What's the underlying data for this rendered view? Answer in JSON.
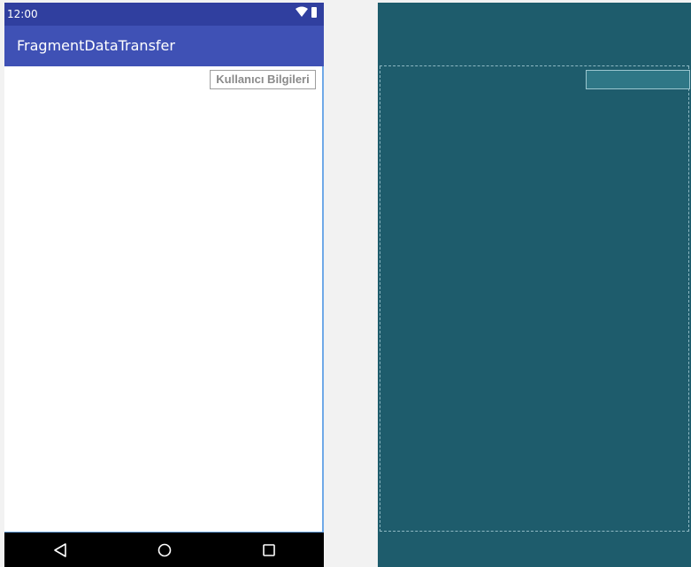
{
  "status_bar": {
    "time": "12:00",
    "icons": [
      "wifi-icon",
      "battery-icon"
    ]
  },
  "app_bar": {
    "title": "FragmentDataTransfer"
  },
  "content": {
    "button_label": "Kullanıcı Bilgileri"
  },
  "nav_bar": {
    "icons": [
      "back-icon",
      "home-icon",
      "recents-icon"
    ]
  },
  "colors": {
    "status_bar": "#303f9f",
    "app_bar": "#3f51b5",
    "blueprint": "#1e5c6c",
    "selection": "#6fa9e8"
  }
}
